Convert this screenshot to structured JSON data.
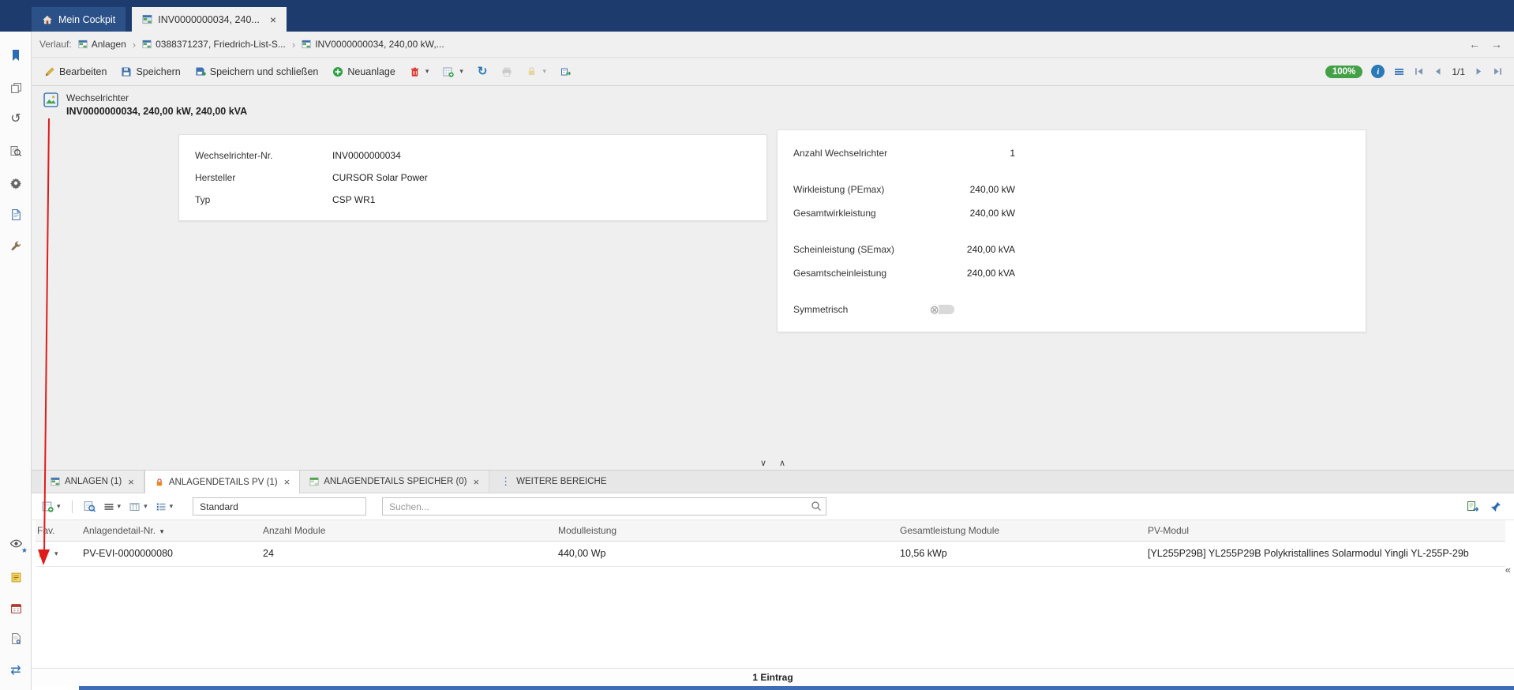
{
  "icons": {
    "caret_down": "▾",
    "close": "×",
    "dots_vertical": "⋮",
    "panel_collapse": "«",
    "sort_indicator": "▼",
    "back_arrow": "←",
    "forward_arrow": "→",
    "collapse_chevron": "∨",
    "expand_chevron": "∧",
    "refresh": "↻",
    "history": "↺",
    "sync": "⇄",
    "info": "i",
    "star": "★",
    "circle_x": "⊗",
    "crumb_separator": "›"
  },
  "colors": {
    "topbar_bg": "#1d3c6d",
    "accent_blue": "#2a6db5",
    "success_green": "#43a047",
    "danger_red": "#d9342b",
    "warning_orange": "#e8882d",
    "annotation_red": "#e01b1b"
  },
  "window_tabs": {
    "cockpit_label": "Mein Cockpit",
    "record_label": "INV0000000034, 240..."
  },
  "history_bar": {
    "label": "Verlauf:",
    "items": [
      {
        "label": "Anlagen"
      },
      {
        "label": "0388371237, Friedrich-List-S..."
      },
      {
        "label": "INV0000000034, 240,00 kW,..."
      }
    ]
  },
  "toolbar": {
    "edit_label": "Bearbeiten",
    "save_label": "Speichern",
    "save_close_label": "Speichern und schließen",
    "new_label": "Neuanlage",
    "zoom_badge": "100%",
    "page_indicator": "1/1"
  },
  "record_header": {
    "type_label": "Wechselrichter",
    "title": "INV0000000034, 240,00 kW, 240,00 kVA"
  },
  "form": {
    "left_fields": [
      {
        "label": "Wechselrichter-Nr.",
        "value": "INV0000000034"
      },
      {
        "label": "Hersteller",
        "value": "CURSOR Solar Power"
      },
      {
        "label": "Typ",
        "value": "CSP WR1"
      }
    ],
    "right_fields": [
      {
        "label": "Anzahl Wechselrichter",
        "value": "1"
      },
      {
        "label": "Wirkleistung (PEmax)",
        "value": "240,00 kW"
      },
      {
        "label": "Gesamtwirkleistung",
        "value": "240,00 kW"
      },
      {
        "label": "Scheinleistung (SEmax)",
        "value": "240,00 kVA"
      },
      {
        "label": "Gesamtscheinleistung",
        "value": "240,00 kVA"
      }
    ],
    "toggle_label": "Symmetrisch"
  },
  "subtabs": {
    "tabs": [
      {
        "label": "ANLAGEN (1)"
      },
      {
        "label": "ANLAGENDETAILS PV (1)"
      },
      {
        "label": "ANLAGENDETAILS SPEICHER (0)"
      }
    ],
    "more_label": "WEITERE BEREICHE"
  },
  "grid_toolbar": {
    "view_value": "Standard",
    "search_placeholder": "Suchen..."
  },
  "grid": {
    "columns": [
      "Fav.",
      "Anlagendetail-Nr.",
      "Anzahl Module",
      "Modulleistung",
      "Gesamtleistung Module",
      "PV-Modul"
    ],
    "rows": [
      {
        "cells": [
          "",
          "PV-EVI-0000000080",
          "24",
          "440,00 Wp",
          "10,56 kWp",
          "[YL255P29B] YL255P29B Polykristallines Solarmodul Yingli YL-255P-29b"
        ]
      }
    ]
  },
  "footer": {
    "count_label": "1 Eintrag"
  }
}
